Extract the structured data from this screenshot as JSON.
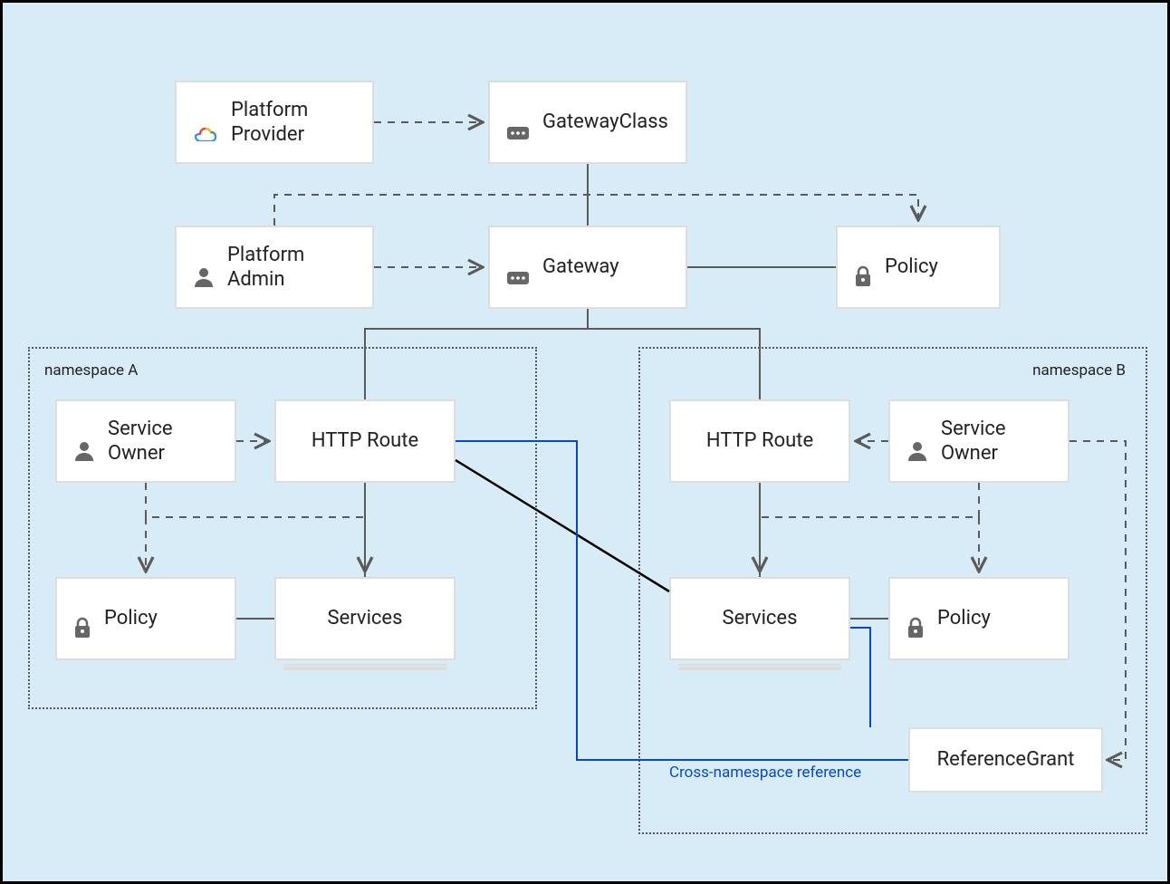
{
  "boxes": {
    "platformProvider": "Platform\nProvider",
    "gatewayClass": "GatewayClass",
    "platformAdmin": "Platform\nAdmin",
    "gateway": "Gateway",
    "policyTop": "Policy",
    "serviceOwnerA": "Service\nOwner",
    "httpRouteA": "HTTP Route",
    "policyA": "Policy",
    "servicesA": "Services",
    "httpRouteB": "HTTP Route",
    "serviceOwnerB": "Service\nOwner",
    "servicesB": "Services",
    "policyB": "Policy",
    "referenceGrant": "ReferenceGrant"
  },
  "namespaces": {
    "a": "namespace A",
    "b": "namespace B"
  },
  "annotation": "Cross-namespace reference",
  "colors": {
    "bg": "#d8ecf8",
    "boxBorder": "#ddd",
    "lineGray": "#5a5a5a",
    "lineBlack": "#000000",
    "lineBlue": "#0a47c2",
    "iconGray": "#666"
  }
}
